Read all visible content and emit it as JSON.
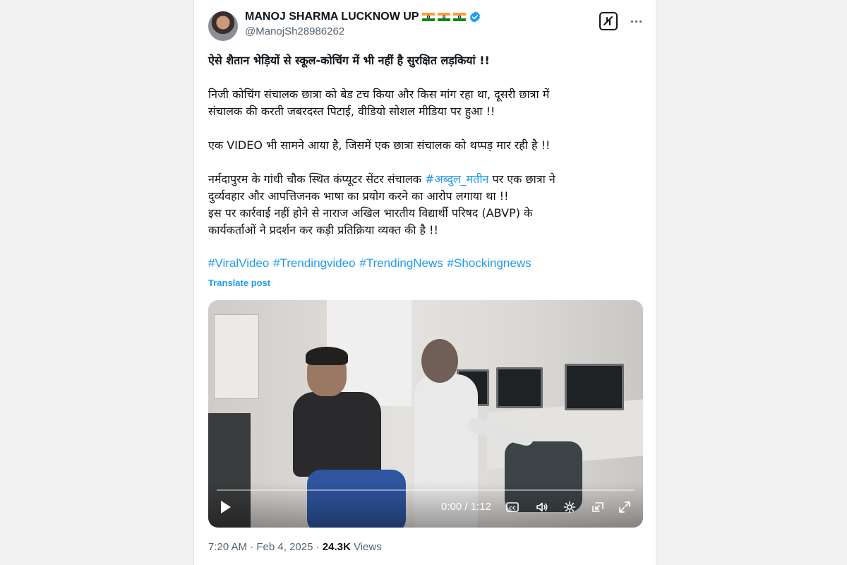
{
  "author": {
    "display_name": "MANOJ SHARMA LUCKNOW UP",
    "handle": "@ManojSh28986262",
    "verified": true,
    "flags": [
      "india-flag",
      "india-flag",
      "india-flag"
    ]
  },
  "header": {
    "grok_icon": "grok-icon",
    "more_icon": "more-options-icon"
  },
  "post": {
    "headline": "ऐसे शैतान भेड़ियों से स्कूल-कोचिंग में भी  नहीं है सुरक्षित लड़कियां !!",
    "para1": [
      "निजी कोचिंग संचालक छात्रा को बेड टच किया और किस मांग रहा था, दूसरी छात्रा में",
      "संचालक की करती जबरदस्त पिटाई, वीडियो सोशल मीडिया पर हुआ !!"
    ],
    "para2": "एक VIDEO भी सामने आया है, जिसमें एक छात्रा संचालक को थप्पड़ मार रही है !!",
    "para3": {
      "line1_before": "नर्मदापुरम के गांधी चौक स्थित कंप्यूटर सेंटर संचालक ",
      "line1_hashtag": "#अब्दुल_मतीन",
      "line1_after": " पर एक छात्रा ने",
      "line2": "दुर्व्यवहार और आपत्तिजनक भाषा का प्रयोग करने का आरोप लगाया था !!",
      "line3": "इस पर कार्रवाई नहीं होने से नाराज अखिल भारतीय विद्यार्थी परिषद (ABVP) के",
      "line4": "कार्यकर्ताओं ने प्रदर्शन कर कड़ी प्रतिक्रिया व्यक्त की है !!"
    },
    "hashtags": [
      "#ViralVideo",
      "#Trendingvideo",
      "#TrendingNews",
      "#Shockingnews"
    ],
    "translate_label": "Translate post"
  },
  "video": {
    "time_display": "0:00 / 1:12",
    "progress": 0,
    "controls": [
      "play-icon",
      "captions-icon",
      "volume-icon",
      "settings-icon",
      "pip-icon",
      "fullscreen-icon"
    ]
  },
  "meta": {
    "time": "7:20 AM",
    "separator": " · ",
    "date": "Feb 4, 2025",
    "views_count": "24.3K",
    "views_label": " Views"
  }
}
